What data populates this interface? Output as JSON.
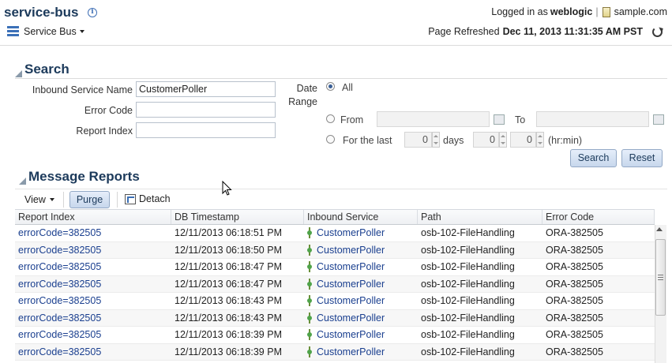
{
  "header": {
    "app_title": "service-bus",
    "logged_in_prefix": "Logged in as",
    "user": "weblogic",
    "separator": "|",
    "domain": "sample.com",
    "menu_label": "Service Bus",
    "refresh_label": "Page Refreshed",
    "refresh_timestamp": "Dec 11, 2013 11:31:35 AM PST"
  },
  "search": {
    "title": "Search",
    "inbound_label": "Inbound Service Name",
    "inbound_value": "CustomerPoller",
    "error_code_label": "Error Code",
    "error_code_value": "",
    "report_index_label": "Report Index",
    "report_index_value": "",
    "date_range_label_1": "Date",
    "date_range_label_2": "Range",
    "opt_all": "All",
    "opt_from": "From",
    "opt_to": "To",
    "opt_last": "For the last",
    "days_value": "0",
    "days_label": "days",
    "hours_value": "0",
    "minutes_value": "0",
    "hrmin_label": "(hr:min)",
    "search_button": "Search",
    "reset_button": "Reset"
  },
  "reports": {
    "title": "Message Reports",
    "view_label": "View",
    "purge_label": "Purge",
    "detach_label": "Detach",
    "columns": [
      "Report Index",
      "DB Timestamp",
      "Inbound Service",
      "Path",
      "Error Code"
    ],
    "rows": [
      [
        "errorCode=382505",
        "12/11/2013 06:18:51 PM",
        "CustomerPoller",
        "osb-102-FileHandling",
        "ORA-382505"
      ],
      [
        "errorCode=382505",
        "12/11/2013 06:18:50 PM",
        "CustomerPoller",
        "osb-102-FileHandling",
        "ORA-382505"
      ],
      [
        "errorCode=382505",
        "12/11/2013 06:18:47 PM",
        "CustomerPoller",
        "osb-102-FileHandling",
        "ORA-382505"
      ],
      [
        "errorCode=382505",
        "12/11/2013 06:18:47 PM",
        "CustomerPoller",
        "osb-102-FileHandling",
        "ORA-382505"
      ],
      [
        "errorCode=382505",
        "12/11/2013 06:18:43 PM",
        "CustomerPoller",
        "osb-102-FileHandling",
        "ORA-382505"
      ],
      [
        "errorCode=382505",
        "12/11/2013 06:18:43 PM",
        "CustomerPoller",
        "osb-102-FileHandling",
        "ORA-382505"
      ],
      [
        "errorCode=382505",
        "12/11/2013 06:18:39 PM",
        "CustomerPoller",
        "osb-102-FileHandling",
        "ORA-382505"
      ],
      [
        "errorCode=382505",
        "12/11/2013 06:18:39 PM",
        "CustomerPoller",
        "osb-102-FileHandling",
        "ORA-382505"
      ]
    ]
  },
  "colors": {
    "title": "#1c3a5b",
    "link": "#1a3f8f",
    "button_border": "#93a9c6"
  },
  "icons": {
    "info": "info-icon",
    "menu": "service-bus-icon",
    "refresh": "refresh-icon",
    "calendar": "calendar-icon",
    "detach": "detach-icon",
    "service": "proxy-service-icon"
  }
}
